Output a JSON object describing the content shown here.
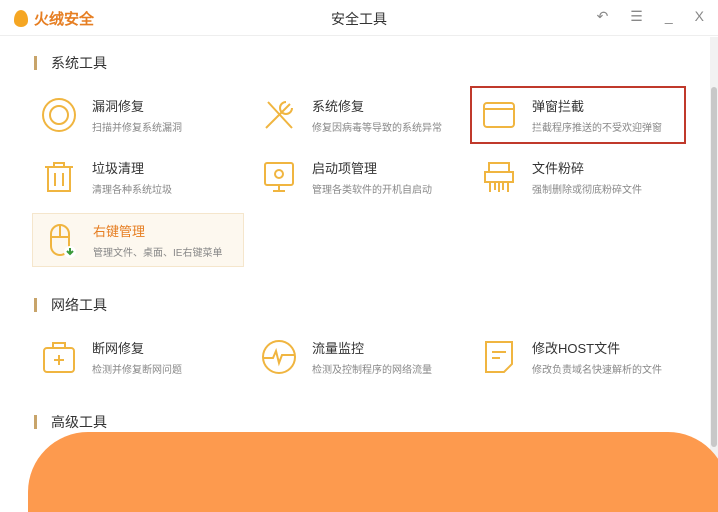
{
  "app": {
    "name": "火绒安全",
    "title": "安全工具"
  },
  "controls": {
    "back": "↶",
    "menu": "☰",
    "minimize": "_",
    "close": "X"
  },
  "sections": [
    {
      "title": "系统工具",
      "items": [
        {
          "name": "漏洞修复",
          "desc": "扫描并修复系统漏洞",
          "icon": "vulnerability-icon"
        },
        {
          "name": "系统修复",
          "desc": "修复因病毒等导致的系统异常",
          "icon": "wrench-screwdriver-icon"
        },
        {
          "name": "弹窗拦截",
          "desc": "拦截程序推送的不受欢迎弹窗",
          "icon": "window-icon"
        },
        {
          "name": "垃圾清理",
          "desc": "清理各种系统垃圾",
          "icon": "trash-icon"
        },
        {
          "name": "启动项管理",
          "desc": "管理各类软件的开机自启动",
          "icon": "monitor-icon"
        },
        {
          "name": "文件粉碎",
          "desc": "强制删除或彻底粉碎文件",
          "icon": "shredder-icon"
        },
        {
          "name": "右键管理",
          "desc": "管理文件、桌面、IE右键菜单",
          "icon": "mouse-icon"
        }
      ]
    },
    {
      "title": "网络工具",
      "items": [
        {
          "name": "断网修复",
          "desc": "检测并修复断网问题",
          "icon": "first-aid-icon"
        },
        {
          "name": "流量监控",
          "desc": "检测及控制程序的网络流量",
          "icon": "pulse-icon"
        },
        {
          "name": "修改HOST文件",
          "desc": "修改负责域名快速解析的文件",
          "icon": "document-icon"
        }
      ]
    },
    {
      "title": "高级工具",
      "items": []
    }
  ]
}
